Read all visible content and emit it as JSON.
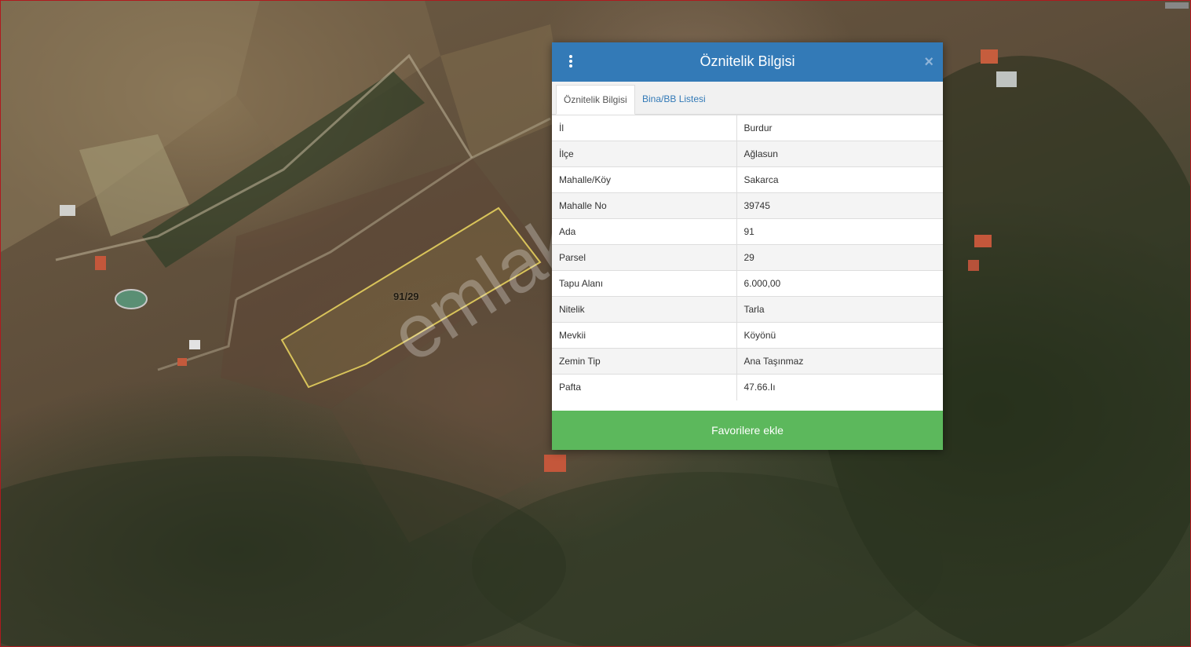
{
  "map": {
    "parcel_label": "91/29",
    "watermark": "emlakjet.com"
  },
  "dialog": {
    "title": "Öznitelik Bilgisi",
    "close_symbol": "×",
    "menu_icon": "vertical-ellipsis-icon",
    "tabs": [
      {
        "label": "Öznitelik Bilgisi",
        "active": true
      },
      {
        "label": "Bina/BB Listesi",
        "active": false
      }
    ],
    "rows": [
      {
        "key": "İl",
        "value": "Burdur"
      },
      {
        "key": "İlçe",
        "value": "Ağlasun"
      },
      {
        "key": "Mahalle/Köy",
        "value": "Sakarca"
      },
      {
        "key": "Mahalle No",
        "value": "39745"
      },
      {
        "key": "Ada",
        "value": "91"
      },
      {
        "key": "Parsel",
        "value": "29"
      },
      {
        "key": "Tapu Alanı",
        "value": "6.000,00"
      },
      {
        "key": "Nitelik",
        "value": "Tarla"
      },
      {
        "key": "Mevkii",
        "value": "Köyönü"
      },
      {
        "key": "Zemin Tip",
        "value": "Ana Taşınmaz"
      },
      {
        "key": "Pafta",
        "value": "47.66.Iı"
      }
    ],
    "favorite_button": "Favorilere ekle"
  },
  "colors": {
    "header": "#337ab7",
    "button": "#5cb85c",
    "parcel_outline": "#d8c35a",
    "map_border": "#b0191e"
  }
}
